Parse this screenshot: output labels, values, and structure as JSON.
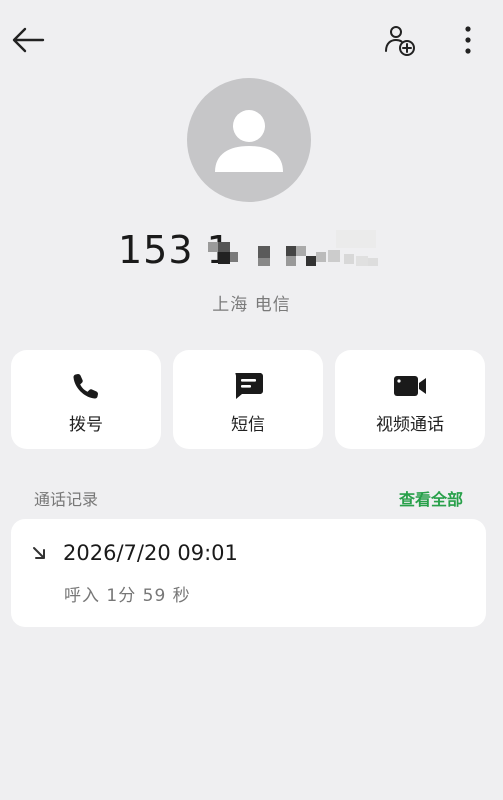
{
  "header": {
    "back_icon": "arrow-left-icon",
    "add_contact_icon": "person-add-icon",
    "more_icon": "more-vertical-icon"
  },
  "contact": {
    "number_visible": "153 1",
    "location": "上海 电信",
    "avatar_icon": "person-placeholder-icon"
  },
  "actions": [
    {
      "label": "拨号",
      "icon": "phone-icon"
    },
    {
      "label": "短信",
      "icon": "message-icon"
    },
    {
      "label": "视频通话",
      "icon": "video-camera-icon"
    }
  ],
  "call_log": {
    "title": "通话记录",
    "view_all": "查看全部",
    "accent_color": "#28a04a",
    "records": [
      {
        "icon": "incoming-call-arrow-icon",
        "datetime": "2026/7/20 09:01",
        "detail": "呼入 1分 59 秒"
      }
    ]
  }
}
